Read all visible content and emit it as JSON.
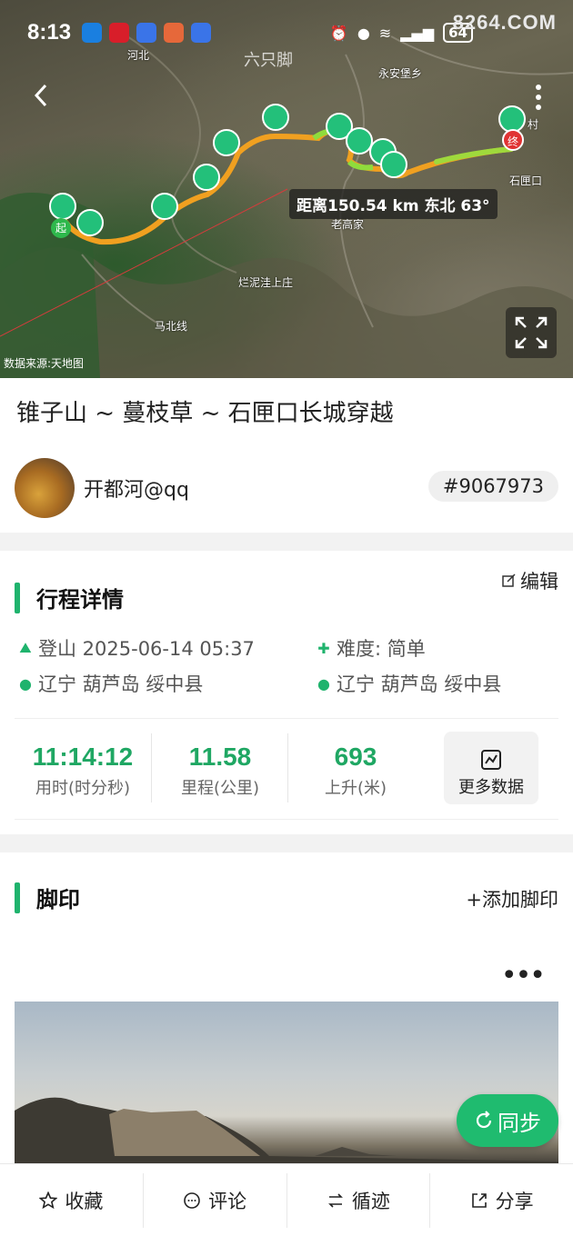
{
  "status_bar": {
    "time": "8:13",
    "battery": "64",
    "watermark": "8264.COM"
  },
  "map": {
    "brand": "六只脚",
    "distance_label": "距离150.54 km 东北 63°",
    "source": "数据来源:天地图",
    "places": [
      "河北",
      "永安堡乡",
      "石匣口",
      "老高家",
      "烂泥洼上庄",
      "马北线",
      "村"
    ],
    "start_marker": "起",
    "end_marker": "终"
  },
  "track": {
    "title": "锥子山 ~ 蔓枝草 ~ 石匣口长城穿越",
    "author": "开都河@qq",
    "id_tag": "#9067973"
  },
  "details": {
    "heading": "行程详情",
    "edit_label": "编辑",
    "type_date": "登山 2025-06-14 05:37",
    "difficulty": "难度: 简单",
    "start_place": "辽宁 葫芦岛 绥中县",
    "end_place": "辽宁 葫芦岛 绥中县",
    "stats": [
      {
        "value": "11:14:12",
        "label": "用时(时分秒)"
      },
      {
        "value": "11.58",
        "label": "里程(公里)"
      },
      {
        "value": "693",
        "label": "上升(米)"
      }
    ],
    "more_data": "更多数据"
  },
  "footprints": {
    "heading": "脚印",
    "add_label": "+添加脚印",
    "menu": "•••",
    "sync_label": "同步"
  },
  "bottom_bar": [
    {
      "label": "收藏",
      "icon": "star-icon"
    },
    {
      "label": "评论",
      "icon": "comment-icon"
    },
    {
      "label": "循迹",
      "icon": "route-icon"
    },
    {
      "label": "分享",
      "icon": "share-icon"
    }
  ]
}
